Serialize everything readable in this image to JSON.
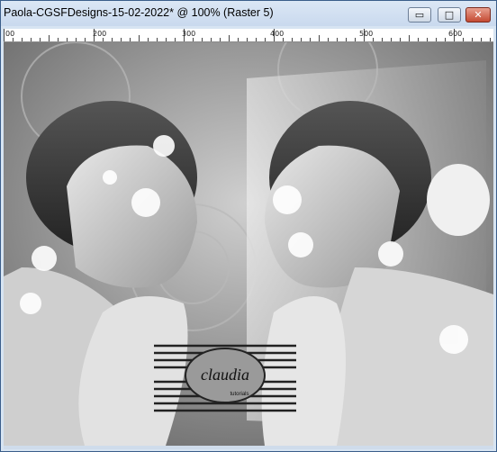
{
  "window": {
    "title": "Paola-CGSFDesigns-15-02-2022* @ 100% (Raster 5)",
    "min_glyph": "▭",
    "max_glyph": "□",
    "close_glyph": "✕"
  },
  "ruler": {
    "labels": [
      "00",
      "200",
      "300",
      "400",
      "500",
      "600"
    ]
  },
  "canvas": {
    "watermark": {
      "text": "claudia",
      "tagline": "tutorials"
    }
  },
  "colors": {
    "titlebar": "#c9d9ee",
    "close_button": "#c44a33"
  },
  "icons": {
    "minimize": "minimize-icon",
    "maximize": "maximize-icon",
    "close": "close-icon"
  }
}
